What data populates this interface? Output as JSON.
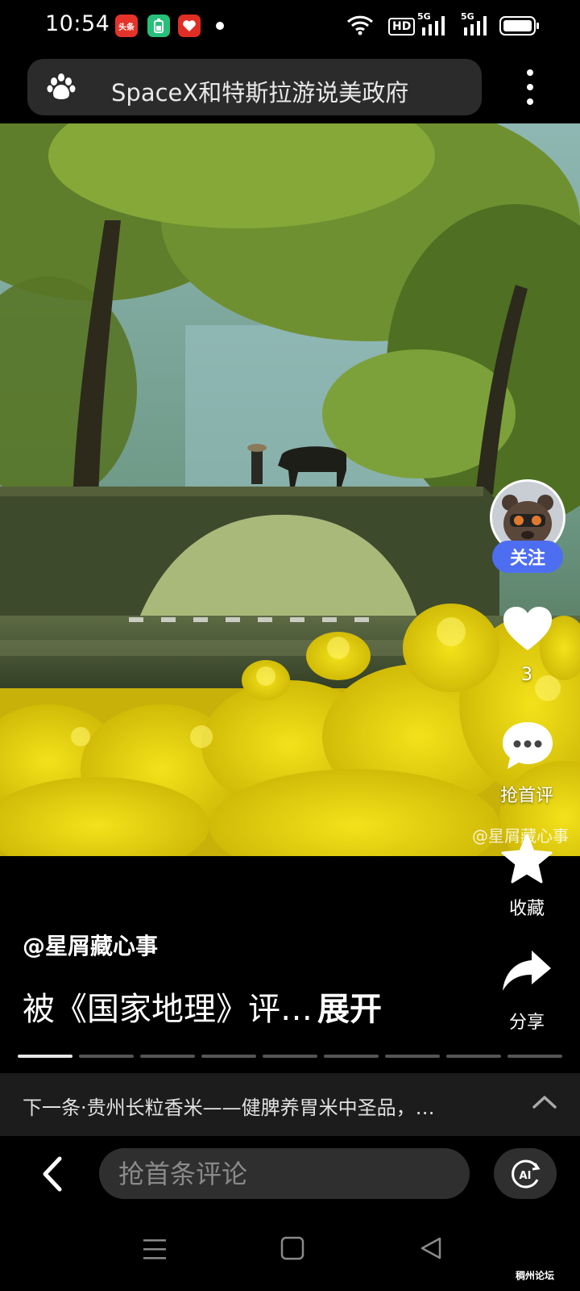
{
  "status_bar": {
    "time": "10:54",
    "notifications": [
      {
        "name": "toutiao-icon",
        "label": "头条"
      },
      {
        "name": "battery-app-icon",
        "label": ""
      },
      {
        "name": "pinduoduo-icon",
        "label": ""
      }
    ],
    "hd_label": "HD",
    "network_1": "5G",
    "network_2": "5G"
  },
  "search": {
    "query": "SpaceX和特斯拉游说美政府"
  },
  "video": {
    "watermark": "@星屑藏心事"
  },
  "actions": {
    "follow_label": "关注",
    "like_count": "3",
    "comment_label": "抢首评",
    "favorite_label": "收藏",
    "share_label": "分享"
  },
  "post": {
    "author": "@星屑藏心事",
    "caption": "被《国家地理》评…",
    "expand_label": "展开"
  },
  "progress": {
    "segments": 9,
    "active_index": 0
  },
  "next": {
    "text": "下一条·贵州长粒香米——健脾养胃米中圣品，…"
  },
  "comment_bar": {
    "placeholder": "抢首条评论",
    "ai_label": "AI"
  },
  "footer": {
    "forum_logo": "稠州论坛"
  },
  "colors": {
    "accent_blue": "#4e6ef2",
    "background": "#000000",
    "pill_gray": "#2f2f2f"
  }
}
